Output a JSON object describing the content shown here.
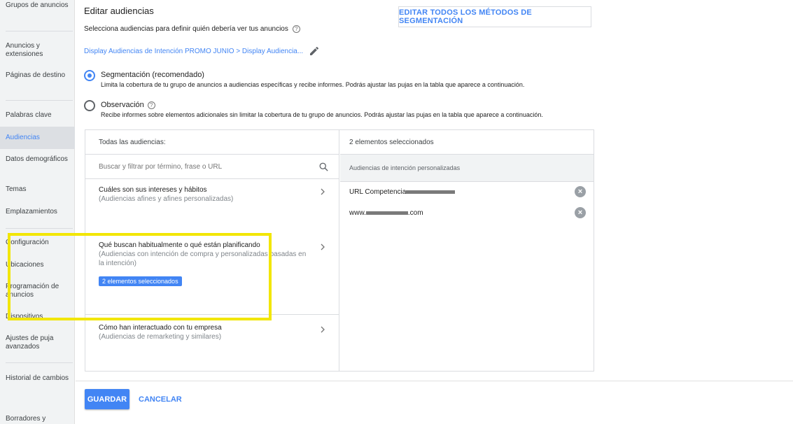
{
  "sidebar": {
    "items": [
      {
        "label": "Grupos de anuncios"
      },
      {
        "label": "Anuncios y extensiones"
      },
      {
        "label": "Páginas de destino"
      },
      {
        "label": "Palabras clave"
      },
      {
        "label": "Audiencias"
      },
      {
        "label": "Datos demográficos"
      },
      {
        "label": "Temas"
      },
      {
        "label": "Emplazamientos"
      },
      {
        "label": "Configuración"
      },
      {
        "label": "Ubicaciones"
      },
      {
        "label": "Programación de anuncios"
      },
      {
        "label": "Dispositivos"
      },
      {
        "label": "Ajustes de puja avanzados"
      },
      {
        "label": "Historial de cambios"
      },
      {
        "label": "Borradores y"
      }
    ],
    "active_item": "Audiencias"
  },
  "header": {
    "title": "Editar audiencias",
    "subtitle": "Selecciona audiencias para definir quién debería ver tus anuncios",
    "edit_all_button": "EDITAR TODOS LOS MÉTODOS DE SEGMENTACIÓN",
    "ad_group_link": "Display Audiencias de Intención PROMO JUNIO > Display Audiencia..."
  },
  "targeting": {
    "options": [
      {
        "label": "Segmentación (recomendado)",
        "description": "Limita la cobertura de tu grupo de anuncios a audiencias específicas y recibe informes. Podrás ajustar las pujas en la tabla que aparece a continuación.",
        "selected": true
      },
      {
        "label": "Observación",
        "description": "Recibe informes sobre elementos adicionales sin limitar la cobertura de tu grupo de anuncios. Podrás ajustar las pujas en la tabla que aparece a continuación.",
        "selected": false
      }
    ]
  },
  "browse": {
    "header": "Todas las audiencias:",
    "search_placeholder": "Buscar y filtrar por término, frase o URL",
    "categories": [
      {
        "title": "Cuáles son sus intereses y hábitos",
        "description": "(Audiencias afines y afines personalizadas)"
      },
      {
        "title": "Qué buscan habitualmente o qué están planificando",
        "description": "(Audiencias con intención de compra y personalizadas basadas en la intención)",
        "badge": "2 elementos seleccionados"
      },
      {
        "title": "Cómo han interactuado con tu empresa",
        "description": "(Audiencias de remarketing y similares)"
      }
    ]
  },
  "selected": {
    "header": "2 elementos seleccionados",
    "group_label": "Audiencias de intención personalizadas",
    "items": [
      {
        "prefix": "URL Competencia",
        "suffix": ""
      },
      {
        "prefix": "www.",
        "suffix": ".com"
      }
    ]
  },
  "footer": {
    "save_label": "GUARDAR",
    "cancel_label": "CANCELAR"
  },
  "colors": {
    "accent": "#4285f4",
    "highlight": "#f2e602"
  }
}
